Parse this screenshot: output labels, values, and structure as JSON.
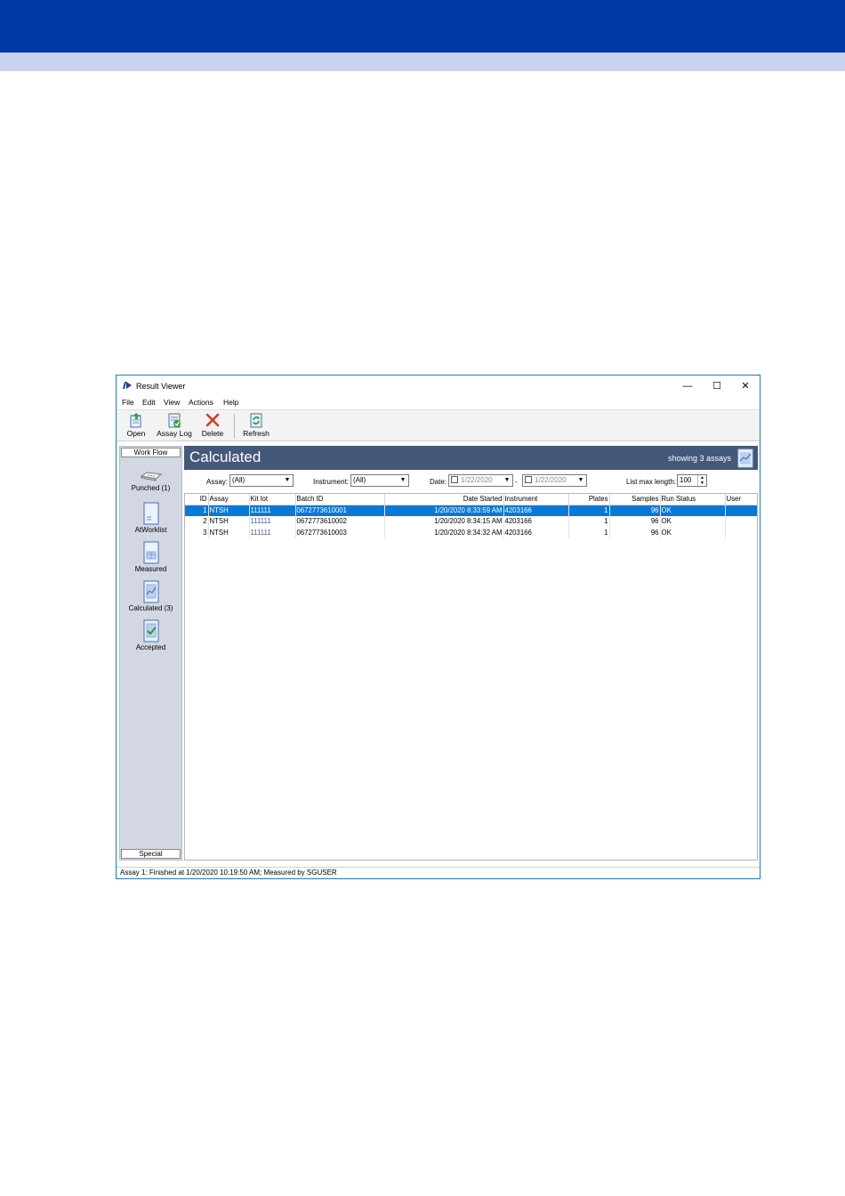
{
  "window": {
    "title": "Result Viewer",
    "controls": {
      "minimize": "—",
      "maximize": "☐",
      "close": "✕"
    }
  },
  "menu": [
    "File",
    "Edit",
    "View",
    "Actions",
    "Help"
  ],
  "toolbar": {
    "open_label": "Open",
    "assay_log_label": "Assay Log",
    "delete_label": "Delete",
    "refresh_label": "Refresh"
  },
  "sidebar": {
    "header": "Work Flow",
    "items": [
      {
        "label": "Punched (1)",
        "icon": "punch-card-icon"
      },
      {
        "label": "AtWorklist",
        "icon": "document-icon"
      },
      {
        "label": "Measured",
        "icon": "measured-document-icon"
      },
      {
        "label": "Calculated (3)",
        "icon": "calculated-document-icon"
      },
      {
        "label": "Accepted",
        "icon": "accepted-document-icon"
      }
    ],
    "footer": "Special"
  },
  "banner": {
    "title": "Calculated",
    "count_text": "showing 3 assays"
  },
  "filters": {
    "assay_label": "Assay:",
    "assay_value": "(All)",
    "instrument_label": "Instrument:",
    "instrument_value": "(All)",
    "date_label": "Date:",
    "date_from": "1/22/2020",
    "date_sep": "-",
    "date_to": "1/22/2020",
    "list_max_label": "List max length:",
    "list_max_value": "100"
  },
  "table": {
    "columns": [
      "ID",
      "Assay",
      "Kit lot",
      "Batch ID",
      "Date Started",
      "Instrument",
      "Plates",
      "Samples",
      "Run Status",
      "User"
    ],
    "rows": [
      {
        "id": "1",
        "assay": "NTSH",
        "kit_lot": "111111",
        "batch_id": "0672773610001",
        "date_started": "1/20/2020 8:33:59 AM",
        "instrument": "4203166",
        "plates": "1",
        "samples": "96",
        "run_status": "OK",
        "user": ""
      },
      {
        "id": "2",
        "assay": "NTSH",
        "kit_lot": "111111",
        "batch_id": "0672773610002",
        "date_started": "1/20/2020 8:34:15 AM",
        "instrument": "4203166",
        "plates": "1",
        "samples": "96",
        "run_status": "OK",
        "user": ""
      },
      {
        "id": "3",
        "assay": "NTSH",
        "kit_lot": "111111",
        "batch_id": "0672773610003",
        "date_started": "1/20/2020 8:34:32 AM",
        "instrument": "4203166",
        "plates": "1",
        "samples": "96",
        "run_status": "OK",
        "user": ""
      }
    ],
    "selected_row": 0
  },
  "status": "Assay 1: Finished at 1/20/2020 10:19:50 AM; Measured by SGUSER",
  "colors": {
    "top_bar": "#0039a6",
    "sub_bar": "#c9d3ef",
    "banner": "#44587a",
    "selection": "#0a78d7",
    "sidebar": "#d3d6e3"
  }
}
